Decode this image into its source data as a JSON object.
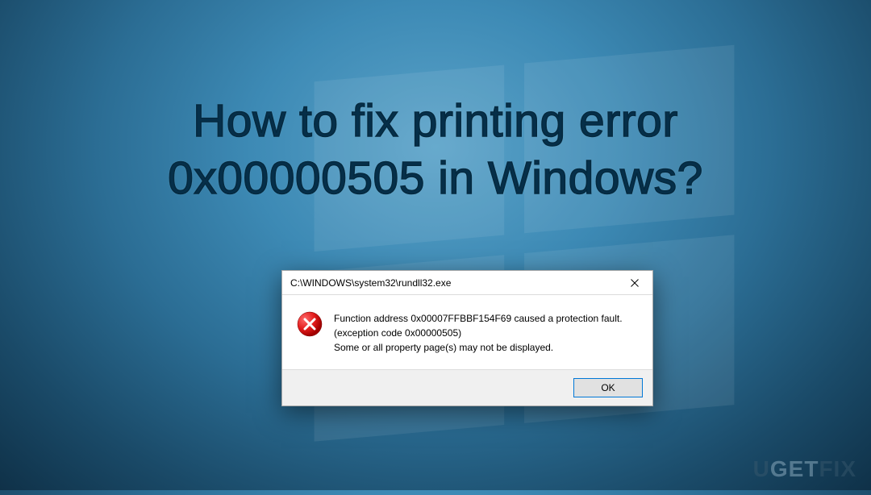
{
  "headline": {
    "line1": "How to fix printing error",
    "line2": "0x00000505 in Windows?"
  },
  "dialog": {
    "title": "C:\\WINDOWS\\system32\\rundll32.exe",
    "message_line1": "Function address 0x00007FFBBF154F69 caused a protection fault.",
    "message_line2": "(exception code 0x00000505)",
    "message_line3": "Some or all property page(s) may not be displayed.",
    "ok_label": "OK"
  },
  "watermark": {
    "text": "UGETFIX"
  }
}
